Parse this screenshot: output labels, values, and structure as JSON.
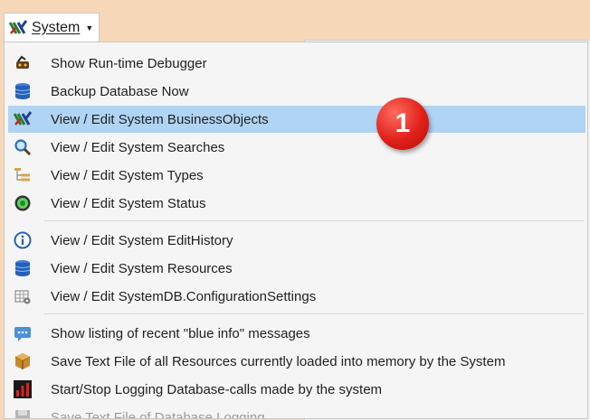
{
  "menu_button": {
    "label": "System",
    "icon": "system-logo-icon"
  },
  "menu": {
    "items": [
      {
        "label": "Show Run-time Debugger",
        "icon": "debugger-icon"
      },
      {
        "label": "Backup Database Now",
        "icon": "database-icon"
      },
      {
        "label": "View / Edit System BusinessObjects",
        "icon": "system-logo-icon",
        "highlighted": true
      },
      {
        "label": "View / Edit System Searches",
        "icon": "magnifier-icon"
      },
      {
        "label": "View / Edit System Types",
        "icon": "tree-icon"
      },
      {
        "label": "View / Edit System Status",
        "icon": "status-icon"
      },
      {
        "label": "View / Edit System EditHistory",
        "icon": "info-icon"
      },
      {
        "label": "View / Edit System Resources",
        "icon": "database-icon"
      },
      {
        "label": "View / Edit SystemDB.ConfigurationSettings",
        "icon": "settings-table-icon"
      },
      {
        "label": "Show listing of recent \"blue info\" messages",
        "icon": "message-icon"
      },
      {
        "label": "Save Text File of all Resources currently loaded into memory by the System",
        "icon": "package-icon"
      },
      {
        "label": "Start/Stop Logging Database-calls made by the system",
        "icon": "bar-chart-icon"
      },
      {
        "label": "Save Text File of Database Logging",
        "icon": "disk-icon",
        "disabled": true
      }
    ]
  },
  "callout": {
    "number": "1"
  },
  "colors": {
    "highlight": "#b0d4f4",
    "background": "#f6d7b8",
    "badge": "#e0201a"
  }
}
